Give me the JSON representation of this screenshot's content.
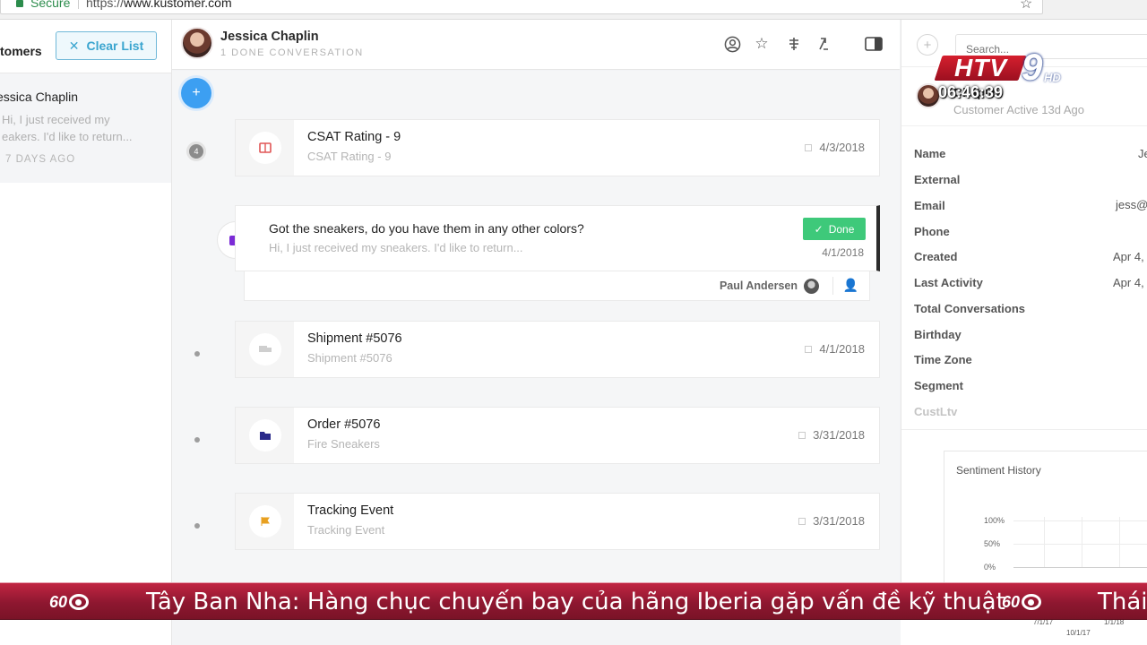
{
  "browser": {
    "secure_label": "Secure",
    "url_scheme": "https://",
    "url_host": "www.kustomer.com"
  },
  "left": {
    "header": "tomers",
    "clear_label": "Clear List",
    "item": {
      "name": "essica Chaplin",
      "preview": "Hi, I just received my eakers. I'd like to return...",
      "ago": "7 DAYS AGO"
    }
  },
  "conversation": {
    "customer_name": "Jessica Chaplin",
    "subtitle": "1 DONE CONVERSATION",
    "count_badge": "4",
    "items": [
      {
        "title": "CSAT Rating - 9",
        "subtitle": "CSAT Rating - 9",
        "date": "4/3/2018",
        "icon": "csat-icon",
        "icon_color": "#e05555"
      },
      {
        "title": "Shipment #5076",
        "subtitle": "Shipment #5076",
        "date": "4/1/2018",
        "icon": "truck-icon",
        "icon_color": "#bbbbbb"
      },
      {
        "title": "Order #5076",
        "subtitle": "Fire Sneakers",
        "date": "3/31/2018",
        "icon": "folder-icon",
        "icon_color": "#2a2a8a"
      },
      {
        "title": "Tracking Event",
        "subtitle": "Tracking Event",
        "date": "3/31/2018",
        "icon": "flag-icon",
        "icon_color": "#e8a020"
      }
    ],
    "message": {
      "title": "Got the sneakers, do you have them in any other colors?",
      "preview": "Hi, I just received my sneakers. I'd like to return...",
      "status": "Done",
      "date": "4/1/2018",
      "agent": "Paul Andersen"
    }
  },
  "right": {
    "search_placeholder": "Search...",
    "name": "Chaplin",
    "status": "Customer Active 13d Ago",
    "attributes": [
      {
        "label": "Name",
        "value": "Je"
      },
      {
        "label": "External",
        "value": ""
      },
      {
        "label": "Email",
        "value": "jess@"
      },
      {
        "label": "Phone",
        "value": ""
      },
      {
        "label": "Created",
        "value": "Apr 4,"
      },
      {
        "label": "Last Activity",
        "value": "Apr 4,"
      },
      {
        "label": "Total Conversations",
        "value": ""
      },
      {
        "label": "Birthday",
        "value": ""
      },
      {
        "label": "Time Zone",
        "value": ""
      },
      {
        "label": "Segment",
        "value": ""
      },
      {
        "label": "CustLtv",
        "value": ""
      }
    ],
    "sentiment": {
      "title": "Sentiment History",
      "yticks": [
        "100%",
        "50%",
        "0%"
      ],
      "xlabels": [
        "7/1/17",
        "10/1/17",
        "1/1/18"
      ]
    }
  },
  "overlay": {
    "channel": "HTV",
    "channel_number": "9",
    "hd": "HD",
    "clock": "06:46:39",
    "ticker_logo": "60",
    "ticker": "Tây Ban Nha: Hàng chục chuyến bay của hãng Iberia gặp vấn đề kỹ thuật",
    "ticker_next": "Thái"
  }
}
